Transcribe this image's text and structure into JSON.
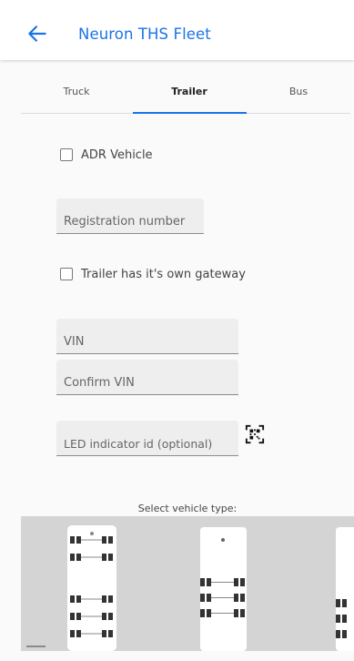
{
  "header": {
    "title": "Neuron THS Fleet",
    "back_icon": "arrow-left-icon",
    "accent_color": "#1a73e8"
  },
  "tabs": [
    {
      "label": "Truck",
      "active": false
    },
    {
      "label": "Trailer",
      "active": true
    },
    {
      "label": "Bus",
      "active": false
    }
  ],
  "form": {
    "adr_checkbox": {
      "label": "ADR Vehicle",
      "checked": false
    },
    "registration": {
      "placeholder": "Registration number",
      "value": ""
    },
    "gateway_checkbox": {
      "label": "Trailer has it's own gateway",
      "checked": false
    },
    "vin": {
      "placeholder": "VIN",
      "value": ""
    },
    "confirm_vin": {
      "placeholder": "Confirm VIN",
      "value": ""
    },
    "led_indicator": {
      "placeholder": "LED indicator id (optional)",
      "value": ""
    },
    "qr_icon": "qr-scan-icon"
  },
  "vehicle_select": {
    "label": "Select vehicle type:",
    "options": [
      {
        "name": "trailer-type-1",
        "icon": "six-axle-trailer-icon"
      },
      {
        "name": "trailer-type-2",
        "icon": "three-axle-trailer-icon"
      },
      {
        "name": "trailer-type-3",
        "icon": "trailer-partial-icon"
      }
    ]
  }
}
